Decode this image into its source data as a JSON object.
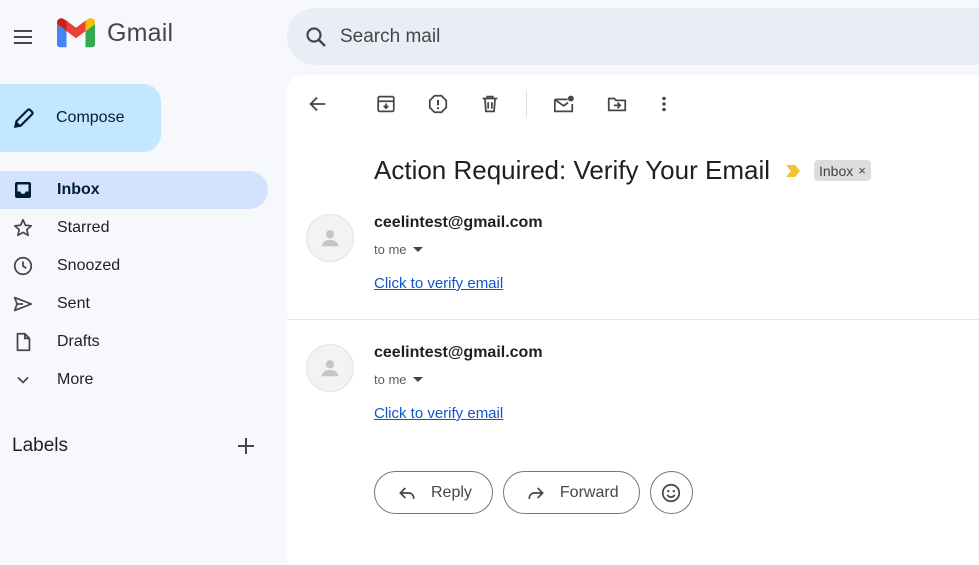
{
  "header": {
    "app_name": "Gmail",
    "search_placeholder": "Search mail"
  },
  "sidebar": {
    "compose_label": "Compose",
    "items": [
      {
        "label": "Inbox",
        "icon": "inbox-icon",
        "active": true
      },
      {
        "label": "Starred",
        "icon": "star-icon",
        "active": false
      },
      {
        "label": "Snoozed",
        "icon": "clock-icon",
        "active": false
      },
      {
        "label": "Sent",
        "icon": "send-icon",
        "active": false
      },
      {
        "label": "Drafts",
        "icon": "draft-icon",
        "active": false
      },
      {
        "label": "More",
        "icon": "chevron-down-icon",
        "active": false
      }
    ],
    "labels_title": "Labels"
  },
  "toolbar": {
    "icons": [
      "back-arrow-icon",
      "archive-icon",
      "report-spam-icon",
      "delete-icon",
      "mark-unread-icon",
      "move-to-icon",
      "more-vert-icon"
    ]
  },
  "thread": {
    "subject": "Action Required: Verify Your Email",
    "label_chip": "Inbox",
    "chip_close": "×",
    "messages": [
      {
        "sender": "ceelintest@gmail.com",
        "recipient": "to me",
        "link": "Click to verify email"
      },
      {
        "sender": "ceelintest@gmail.com",
        "recipient": "to me",
        "link": "Click to verify email"
      }
    ]
  },
  "actions": {
    "reply_label": "Reply",
    "forward_label": "Forward"
  },
  "colors": {
    "background": "#f6f8fc",
    "compose": "#c2e7ff",
    "active_nav": "#d3e3fd",
    "link": "#1155cc",
    "importance": "#f2c232"
  }
}
